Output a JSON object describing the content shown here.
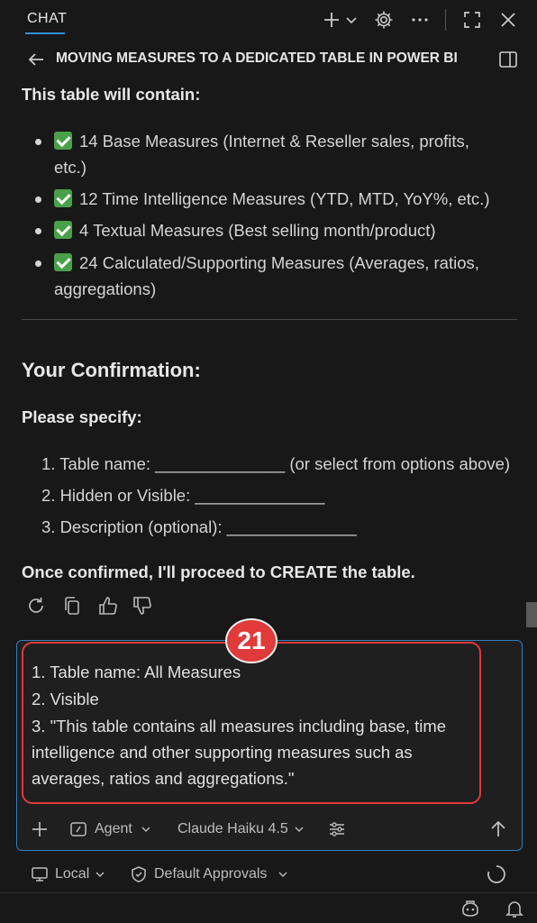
{
  "header": {
    "tab_label": "CHAT",
    "conversation_title": "MOVING MEASURES TO A DEDICATED TABLE IN POWER BI"
  },
  "response": {
    "intro": "This table will contain:",
    "bullets": [
      {
        "line1": "14 Base Measures (Internet & Reseller sales, profits,",
        "line2": "etc.)"
      },
      {
        "line1": "12 Time Intelligence Measures (YTD, MTD, YoY%, etc.)"
      },
      {
        "line1": "4 Textual Measures (Best selling month/product)"
      },
      {
        "line1": "24 Calculated/Supporting Measures (Averages, ratios,",
        "line2": "aggregations)"
      }
    ],
    "confirmation_heading": "Your Confirmation:",
    "please_specify": "Please specify:",
    "numbered": [
      "1. Table name: ______________ (or select from options above)",
      "2. Hidden or Visible: ______________",
      "3. Description (optional): ______________"
    ],
    "closing": "Once confirmed, I'll proceed to CREATE the table."
  },
  "input": {
    "lines": [
      "1. Table name: All Measures",
      "2. Visible",
      "3. \"This table contains all measures including base, time",
      "intelligence and other supporting measures such as",
      "averages, ratios and aggregations.\""
    ],
    "step_badge": "21",
    "mode_label": "Agent",
    "model_label": "Claude Haiku 4.5"
  },
  "status": {
    "location_label": "Local",
    "approvals_label": "Default Approvals"
  },
  "colors": {
    "accent": "#2f7fbf",
    "highlight": "#e03a3a",
    "check": "#4aa04a"
  }
}
